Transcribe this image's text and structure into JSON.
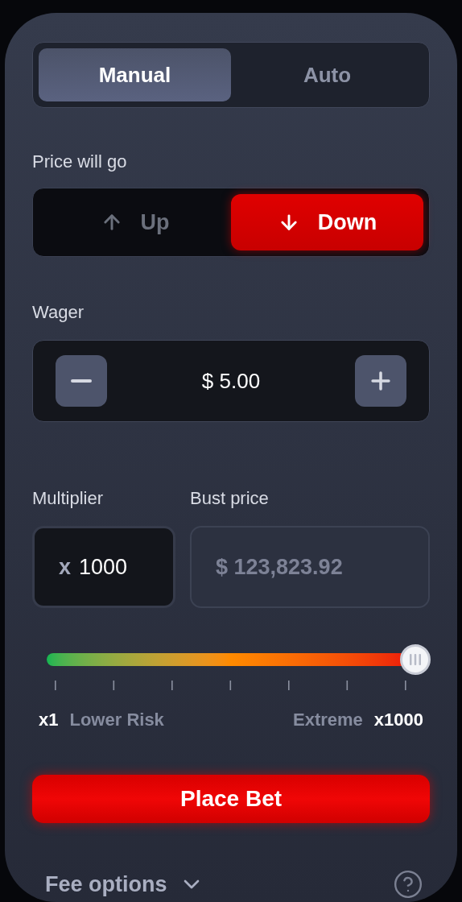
{
  "mode_tabs": [
    {
      "label": "Manual",
      "selected": true
    },
    {
      "label": "Auto",
      "selected": false
    }
  ],
  "direction": {
    "label": "Price will go",
    "options": [
      {
        "label": "Up",
        "kind": "up",
        "selected": false
      },
      {
        "label": "Down",
        "kind": "down",
        "selected": true
      }
    ]
  },
  "wager": {
    "label": "Wager",
    "value": "$ 5.00"
  },
  "multiplier": {
    "label": "Multiplier",
    "prefix": "x",
    "value": "1000"
  },
  "bust_price": {
    "label": "Bust price",
    "value": "$ 123,823.92"
  },
  "risk_slider": {
    "level": 1,
    "min_label": "x1",
    "min_caption": "Lower Risk",
    "max_caption": "Extreme",
    "max_label": "x1000"
  },
  "place_bet": "Place Bet",
  "fee_options": "Fee options"
}
